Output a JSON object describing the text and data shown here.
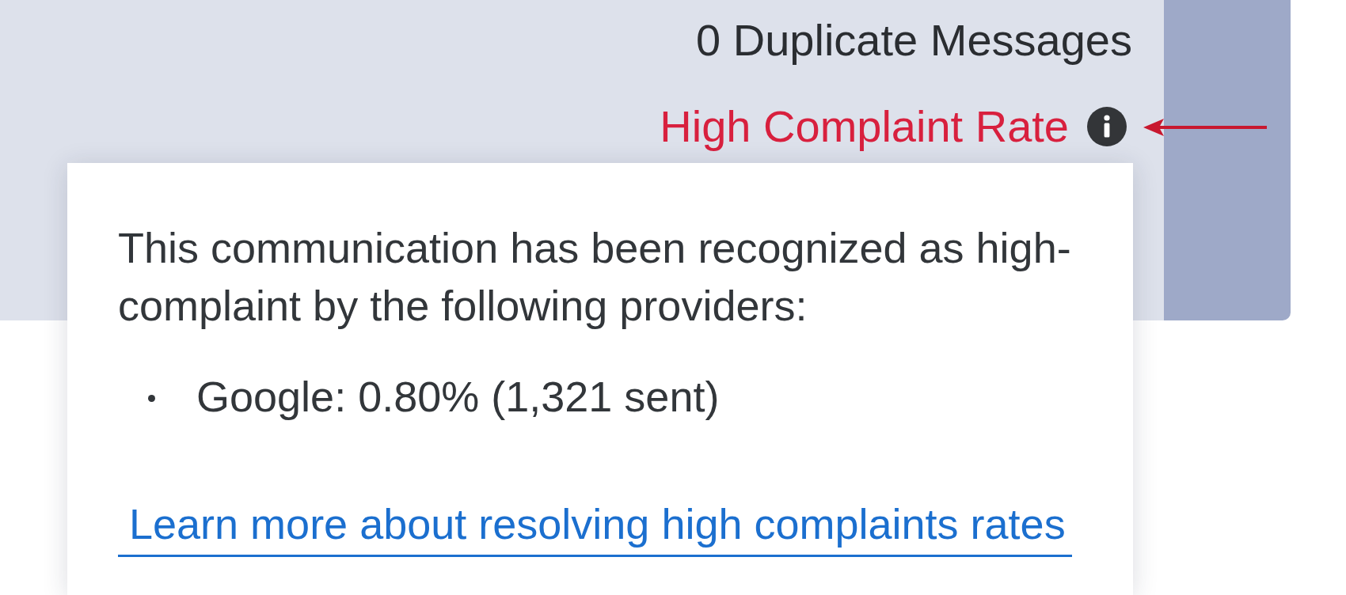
{
  "summary": {
    "duplicate_messages": "0 Duplicate Messages",
    "complaint_status": {
      "label": "High Complaint Rate",
      "warning": true
    }
  },
  "popover": {
    "message": "This communication has been recognized as high-complaint by the following providers:",
    "providers": [
      "Google: 0.80% (1,321 sent)"
    ],
    "link": "Learn more about resolving high complaints rates"
  }
}
